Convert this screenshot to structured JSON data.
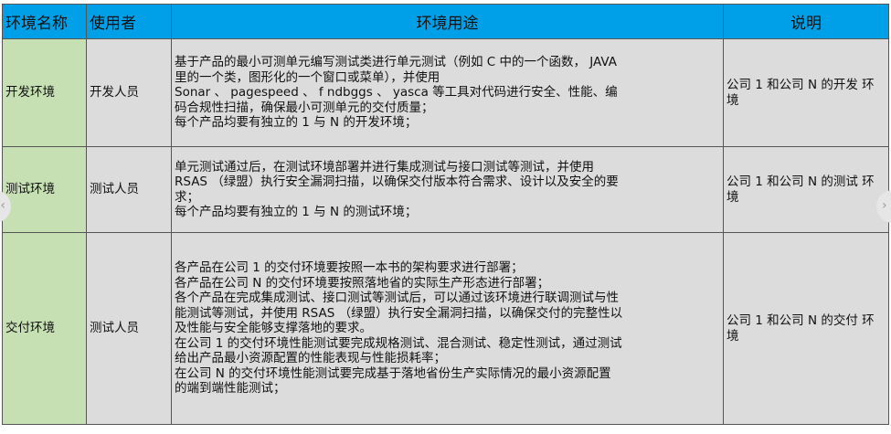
{
  "table": {
    "headers": [
      "环境名称",
      "使用者",
      "环境用途",
      "说明"
    ],
    "rows": [
      {
        "name": "开发环境",
        "user": "开发人员",
        "usage": [
          "基于产品的最小可测单元编写测试类进行单元测试（例如 C 中的一个函数， JAVA",
          "里的一个类，图形化的一个窗口或菜单），并使用",
          "Sonar 、 pagespeed 、 f ndbggs 、 yasca 等工具对代码进行安全、性能、编",
          "码合规性扫描，确保最小可测单元的交付质量；",
          "每个产品均要有独立的 1 与 N 的开发环境；"
        ],
        "note": [
          "公司 1 和公司 N 的开发",
          "环境"
        ]
      },
      {
        "name": "测试环境",
        "user": "测试人员",
        "usage": [
          "单元测试通过后，在测试环境部署并进行集成测试与接口测试等测试，并使用",
          "RSAS （绿盟）执行安全漏洞扫描，以确保交付版本符合需求、设计以及安全的要",
          "求；",
          "每个产品均要有独立的 1 与 N 的测试环境；"
        ],
        "note": [
          "公司 1 和公司 N 的测试",
          "环境"
        ]
      },
      {
        "name": "交付环境",
        "user": "测试人员",
        "usage": [
          "各产品在公司 1 的交付环境要按照一本书的架构要求进行部署；",
          "各产品在公司 N 的交付环境要按照落地省的实际生产形态进行部署；",
          "各个产品在完成集成测试、接口测试等测试后，可以通过该环境进行联调测试与性",
          "能测试等测试，并使用 RSAS （绿盟）执行安全漏洞扫描，以确保交付的完整性以",
          "及性能与安全能够支撑落地的要求。",
          "在公司 1 的交付环境性能测试要完成规格测试、混合测试、稳定性测试，通过测试",
          "给出产品最小资源配置的性能表现与性能损耗率；",
          "在公司 N 的交付环境性能测试要完成基于落地省份生产实际情况的最小资源配置",
          "的端到端性能测试；"
        ],
        "note": [
          "公司 1 和公司 N 的交付",
          "环境"
        ]
      }
    ]
  },
  "carousel": {
    "prev_glyph": "‹",
    "next_glyph": "›"
  }
}
